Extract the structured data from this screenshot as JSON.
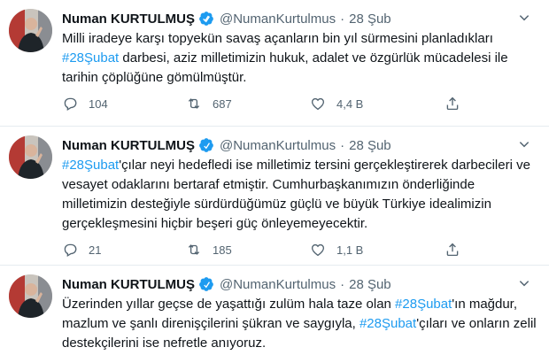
{
  "tweets": [
    {
      "author_name": "Numan KURTULMUŞ",
      "handle": "@NumanKurtulmus",
      "separator": "·",
      "date": "28 Şub",
      "text_parts": [
        {
          "text": "Milli iradeye karşı topyekün savaş açanların bin yıl sürmesini planladıkları ",
          "hashtag": false
        },
        {
          "text": "#28Şubat",
          "hashtag": true
        },
        {
          "text": " darbesi, aziz milletimizin hukuk, adalet ve özgürlük mücadelesi ile tarihin çöplüğüne gömülmüştür.",
          "hashtag": false
        }
      ],
      "replies": "104",
      "retweets": "687",
      "likes": "4,4 B"
    },
    {
      "author_name": "Numan KURTULMUŞ",
      "handle": "@NumanKurtulmus",
      "separator": "·",
      "date": "28 Şub",
      "text_parts": [
        {
          "text": "#28Şubat",
          "hashtag": true
        },
        {
          "text": "'çılar neyi hedefledi ise milletimiz tersini gerçekleştirerek darbecileri ve vesayet odaklarını bertaraf etmiştir. Cumhurbaşkanımızın önderliğinde milletimizin desteğiyle sürdürdüğümüz güçlü ve büyük Türkiye idealimizin gerçekleşmesini hiçbir beşeri güç önleyemeyecektir.",
          "hashtag": false
        }
      ],
      "replies": "21",
      "retweets": "185",
      "likes": "1,1 B"
    },
    {
      "author_name": "Numan KURTULMUŞ",
      "handle": "@NumanKurtulmus",
      "separator": "·",
      "date": "28 Şub",
      "text_parts": [
        {
          "text": "Üzerinden yıllar geçse de yaşattığı zulüm hala taze olan ",
          "hashtag": false
        },
        {
          "text": "#28Şubat",
          "hashtag": true
        },
        {
          "text": "'ın mağdur, mazlum ve şanlı direnişçilerini şükran ve saygıyla, ",
          "hashtag": false
        },
        {
          "text": "#28Şubat",
          "hashtag": true
        },
        {
          "text": "'çıları ve onların zelil destekçilerini ise nefretle anıyoruz.",
          "hashtag": false
        }
      ]
    }
  ],
  "colors": {
    "accent": "#1d9bf0",
    "muted": "#536471",
    "text": "#0f1419",
    "divider": "#e6ecf0"
  },
  "icons": {
    "verified": "verified-badge-icon",
    "more": "more-options-icon",
    "reply": "reply-icon",
    "retweet": "retweet-icon",
    "like": "like-icon",
    "share": "share-icon"
  }
}
